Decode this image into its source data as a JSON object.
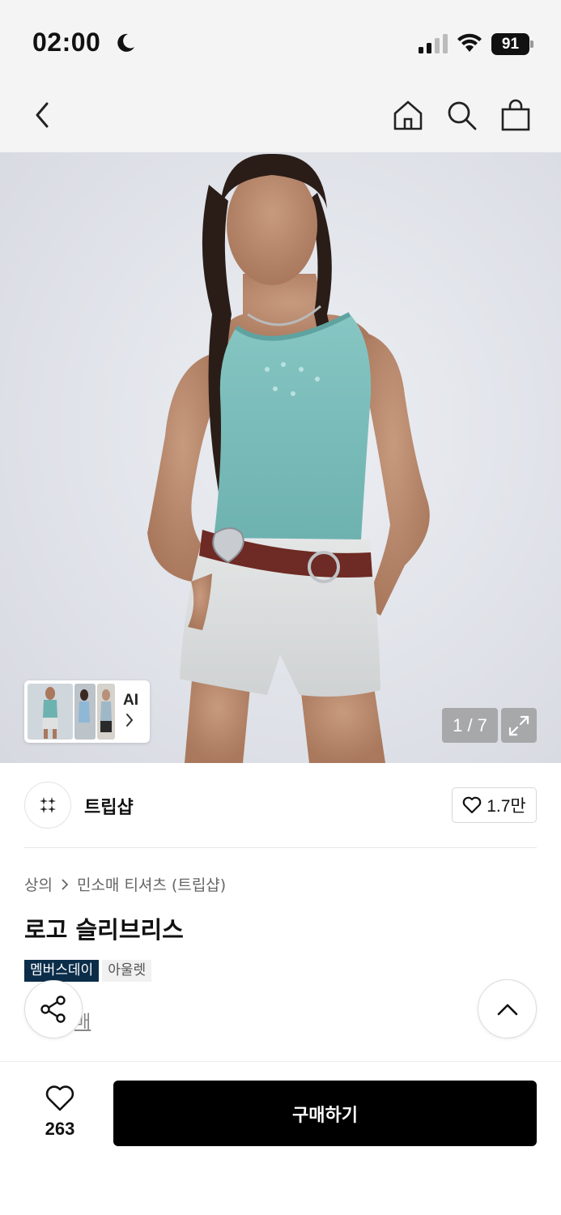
{
  "status_bar": {
    "time": "02:00",
    "battery": "91",
    "icons": [
      "moon-icon",
      "signal-icon",
      "wifi-icon",
      "battery-icon"
    ]
  },
  "nav": {
    "icons": [
      "back-icon",
      "home-icon",
      "search-icon",
      "shopping-bag-icon"
    ]
  },
  "gallery": {
    "ai_label": "AI",
    "page_counter": "1 / 7",
    "current_page": 1,
    "total_pages": 7
  },
  "brand": {
    "name": "트립샵",
    "likes": "1.7만"
  },
  "product": {
    "breadcrumb": [
      "상의",
      "민소매 티셔츠 (트립샵)"
    ],
    "title": "로고 슬리브리스",
    "tags": [
      "멤버스데이",
      "아울렛"
    ],
    "partial_link_text": "매"
  },
  "bottom_bar": {
    "wish_count": "263",
    "buy_label": "구매하기"
  },
  "colors": {
    "member_tag": "#0b2d4a",
    "buy_button": "#000000",
    "top_color": "#7dbdbb"
  }
}
